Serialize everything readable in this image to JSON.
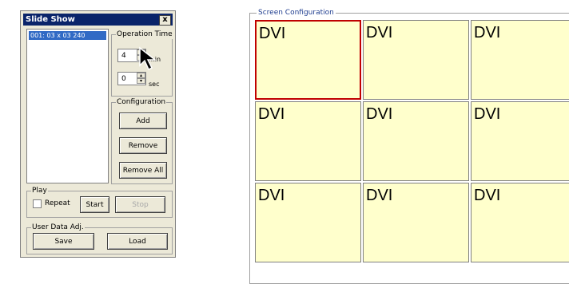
{
  "dialog": {
    "title": "Slide Show",
    "close_label": "x",
    "list_items": [
      "001: 03 x 03  240"
    ],
    "operation_time": {
      "label": "Operation Time",
      "minutes_value": "4",
      "minutes_unit": "min",
      "seconds_value": "0",
      "seconds_unit": "sec"
    },
    "configuration": {
      "label": "Configuration",
      "add_label": "Add",
      "remove_label": "Remove",
      "remove_all_label": "Remove All"
    },
    "play": {
      "label": "Play",
      "repeat_label": "Repeat",
      "repeat_checked": false,
      "start_label": "Start",
      "stop_label": "Stop"
    },
    "user_data": {
      "label": "User Data Adj.",
      "save_label": "Save",
      "load_label": "Load"
    }
  },
  "screen_config": {
    "label": "Screen Configuration",
    "tiles": [
      "DVI",
      "DVI",
      "DVI",
      "DVI",
      "DVI",
      "DVI",
      "DVI",
      "DVI",
      "DVI"
    ],
    "selected_index": 0,
    "colors": {
      "tile_bg": "#ffffcc",
      "selected_border": "#c00000"
    }
  }
}
